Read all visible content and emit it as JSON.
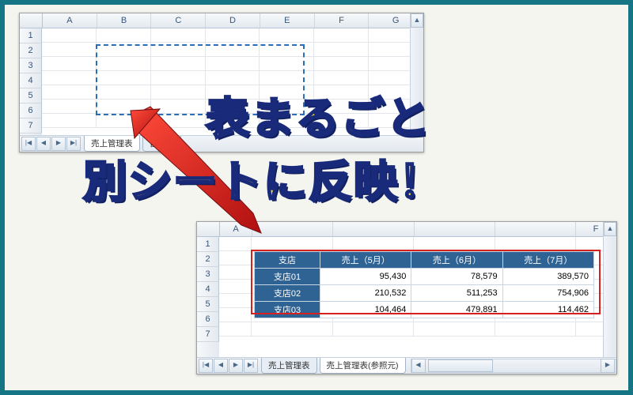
{
  "headline_line1": "表まるごと",
  "headline_line2": "別シートに反映！",
  "window1": {
    "columns": [
      "A",
      "B",
      "C",
      "D",
      "E",
      "F",
      "G"
    ],
    "rows": [
      "1",
      "2",
      "3",
      "4",
      "5",
      "6",
      "7"
    ],
    "tabs": [
      "売上管理表",
      "管理表"
    ]
  },
  "window2": {
    "columns": [
      "A",
      "",
      "",
      "",
      "",
      "F"
    ],
    "rows": [
      "1",
      "2",
      "3",
      "4",
      "5",
      "6",
      "7"
    ],
    "tabs": [
      "売上管理表",
      "売上管理表(参照元)"
    ],
    "table": {
      "headers": [
        "支店",
        "売上（5月）",
        "売上（6月）",
        "売上（7月）"
      ],
      "data": [
        [
          "支店01",
          "95,430",
          "78,579",
          "389,570"
        ],
        [
          "支店02",
          "210,532",
          "511,253",
          "754,906"
        ],
        [
          "支店03",
          "104,464",
          "479,891",
          "114,462"
        ]
      ]
    }
  },
  "chart_data": {
    "type": "table",
    "title": "売上管理表",
    "columns": [
      "支店",
      "売上（5月）",
      "売上（6月）",
      "売上（7月）"
    ],
    "rows": [
      {
        "支店": "支店01",
        "売上（5月）": 95430,
        "売上（6月）": 78579,
        "売上（7月）": 389570
      },
      {
        "支店": "支店02",
        "売上（5月）": 210532,
        "売上（6月）": 511253,
        "売上（7月）": 754906
      },
      {
        "支店": "支店03",
        "売上（5月）": 104464,
        "売上（6月）": 479891,
        "売上（7月）": 114462
      }
    ]
  }
}
